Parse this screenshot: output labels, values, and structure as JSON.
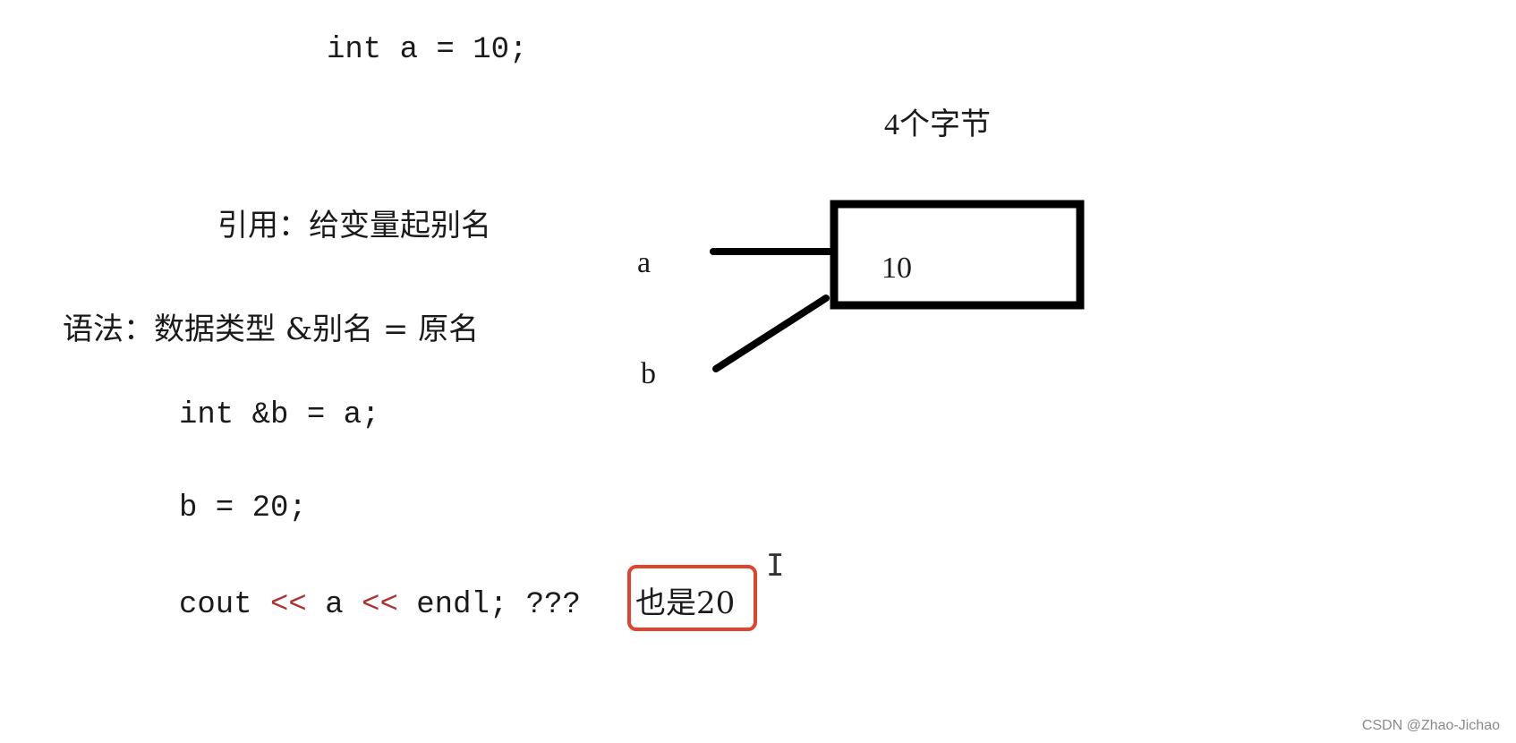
{
  "code": {
    "declaration": "int a = 10;",
    "reference_decl": "int &b = a;",
    "assignment": "b = 20;",
    "output_parts": {
      "cout": "cout ",
      "op1": "<<",
      "a": " a ",
      "op2": "<<",
      "endl": " endl; ???"
    }
  },
  "notes": {
    "definition": "引用：给变量起别名",
    "syntax": "语法：数据类型 &别名 = 原名",
    "answer": "也是20"
  },
  "diagram": {
    "size_label": "4个字节",
    "box_value": "10",
    "var_a": "a",
    "var_b": "b"
  },
  "colors": {
    "highlight_border": "#e0442c",
    "operator": "#b03030"
  },
  "watermark": "CSDN @Zhao-Jichao"
}
